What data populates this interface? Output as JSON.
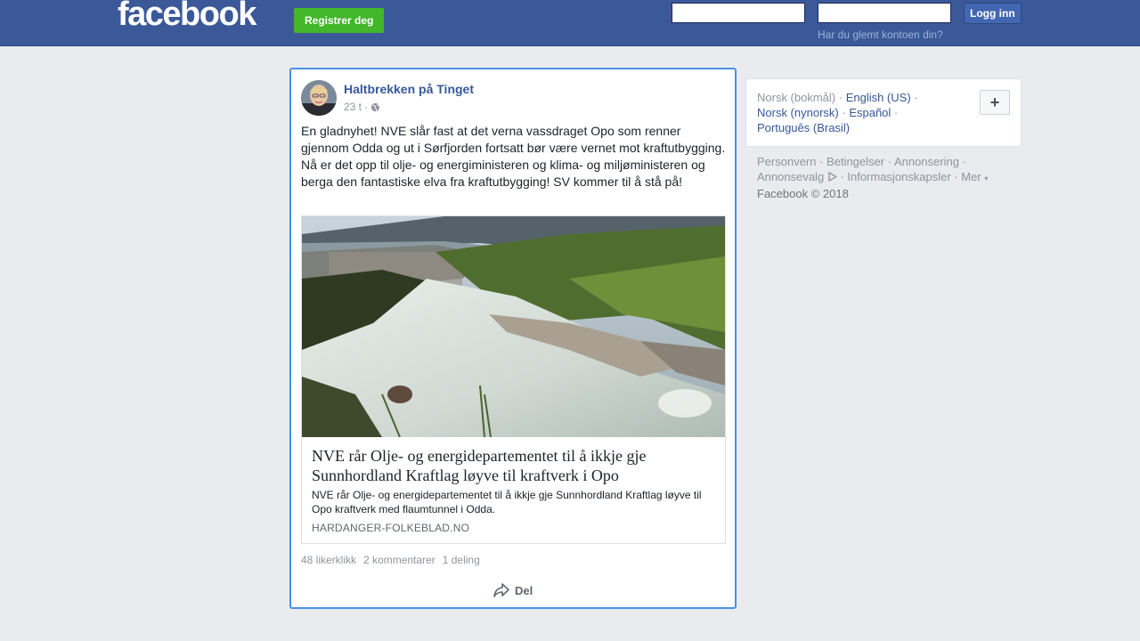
{
  "header": {
    "logo": "facebook",
    "register_label": "Registrer deg",
    "login_label": "Logg inn",
    "forgot_label": "Har du glemt kontoen din?",
    "email_value": "",
    "password_value": ""
  },
  "post": {
    "author": "Haltbrekken på Tinget",
    "time": "23 t",
    "separator": "·",
    "text": "En gladnyhet! NVE slår fast at det verna vassdraget Opo som renner gjennom Odda og ut i Sørfjorden fortsatt bør være vernet mot kraftutbygging. Nå er det opp til olje- og energiministeren og klima- og miljøministeren og berga den fantastiske elva fra kraftutbygging! SV kommer til å stå på!",
    "link": {
      "title": "NVE rår Olje- og energidepartementet til å ikkje gje Sunnhordland Kraftlag løyve til kraftverk i Opo",
      "description": "NVE rår Olje- og energidepartementet til å ikkje gje Sunnhordland Kraftlag løyve til Opo kraftverk med flaumtunnel i Odda.",
      "domain": "HARDANGER-FOLKEBLAD.NO"
    },
    "stats": {
      "likes": "48 likerklikk",
      "comments": "2 kommentarer",
      "shares": "1 deling"
    },
    "share_label": "Del"
  },
  "languages": {
    "current": "Norsk (bokmål)",
    "others": [
      "English (US)",
      "Norsk (nynorsk)",
      "Español",
      "Português (Brasil)"
    ],
    "more_label": "+"
  },
  "footer": {
    "links": [
      "Personvern",
      "Betingelser",
      "Annonsering",
      "Annonsevalg",
      "Informasjonskapsler",
      "Mer"
    ],
    "copyright": "Facebook © 2018"
  },
  "colors": {
    "brand_blue": "#3b5998",
    "register_green": "#42b72a",
    "link_blue": "#365899",
    "focus_border": "#4a90e2"
  }
}
